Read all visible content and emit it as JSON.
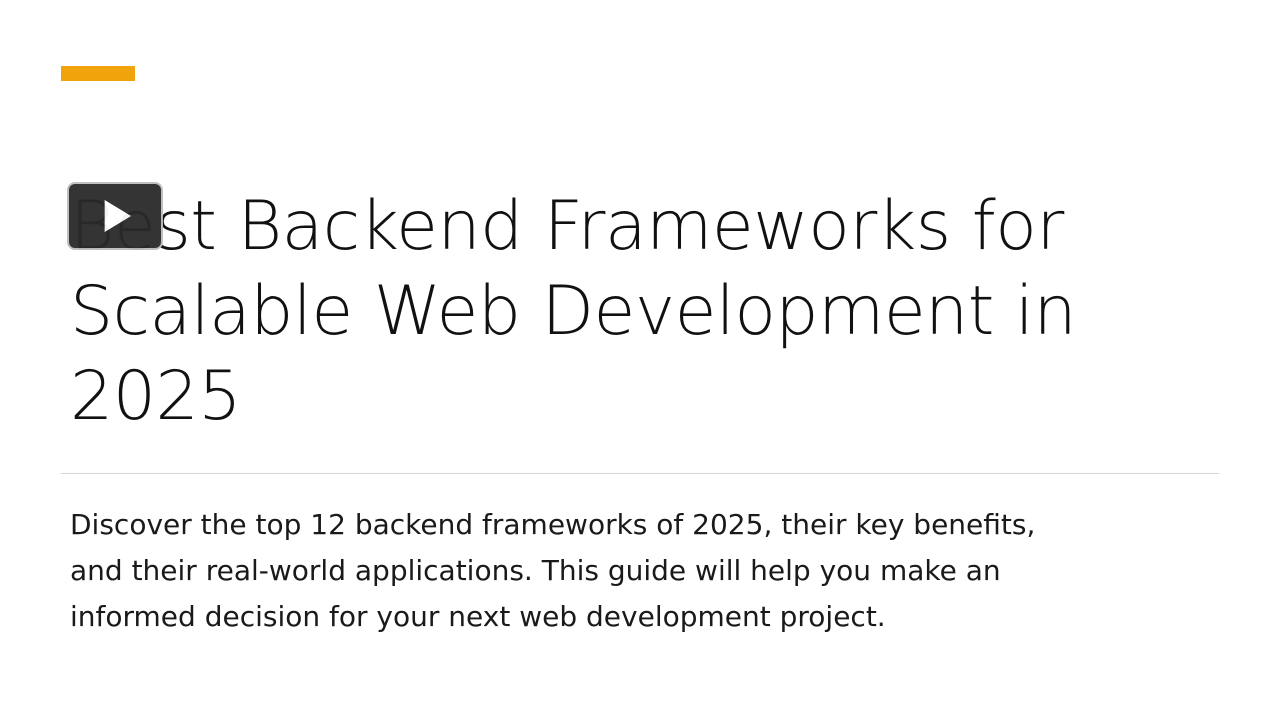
{
  "slide": {
    "title": "Best Backend Frameworks for\nScalable Web Development in\n2025",
    "subtitle": "Discover the top 12 backend frameworks of 2025, their key benefits,\nand their real-world applications. This guide will help you make an\ninformed decision for your next web development project."
  },
  "player": {
    "play_icon": "play-icon"
  },
  "colors": {
    "accent": "#f0a30a",
    "divider": "#d6d6d6",
    "text": "#111111"
  }
}
